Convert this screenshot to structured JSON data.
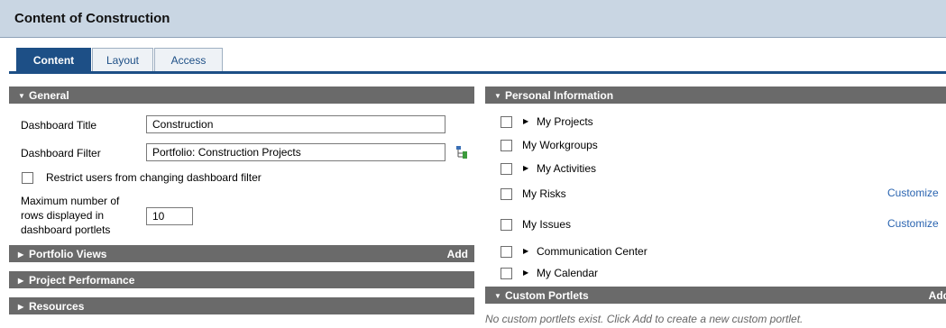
{
  "page": {
    "title": "Content of Construction"
  },
  "tabs": [
    {
      "label": "Content",
      "active": true
    },
    {
      "label": "Layout",
      "active": false
    },
    {
      "label": "Access",
      "active": false
    }
  ],
  "general": {
    "header": "General",
    "dashboard_title_label": "Dashboard Title",
    "dashboard_title_value": "Construction",
    "dashboard_filter_label": "Dashboard Filter",
    "dashboard_filter_value": "Portfolio: Construction Projects",
    "filter_picker_icon": "hierarchy-icon",
    "restrict_label": "Restrict users from changing dashboard filter",
    "max_rows_label_1": "Maximum number of",
    "max_rows_label_2": "rows displayed in",
    "max_rows_label_3": "dashboard portlets",
    "max_rows_value": "10"
  },
  "portfolio_views": {
    "header": "Portfolio Views",
    "add_label": "Add"
  },
  "project_performance": {
    "header": "Project Performance"
  },
  "resources": {
    "header": "Resources"
  },
  "personal_information": {
    "header": "Personal Information",
    "items": [
      {
        "label": "My Projects",
        "expandable": true
      },
      {
        "label": "My Workgroups",
        "expandable": false
      },
      {
        "label": "My Activities",
        "expandable": true
      },
      {
        "label": "My Risks",
        "expandable": false,
        "link": "Customize"
      },
      {
        "label": "My Issues",
        "expandable": false,
        "link": "Customize"
      },
      {
        "label": "Communication Center",
        "expandable": true
      },
      {
        "label": "My Calendar",
        "expandable": true
      }
    ]
  },
  "custom_portlets": {
    "header": "Custom Portlets",
    "add_label": "Add",
    "empty_message": "No custom portlets exist. Click Add to create a new custom portlet."
  },
  "colors": {
    "tab_active": "#1d4f86",
    "section_bar": "#6a6a6a",
    "title_bar": "#c9d6e3",
    "link": "#2a64b0"
  }
}
